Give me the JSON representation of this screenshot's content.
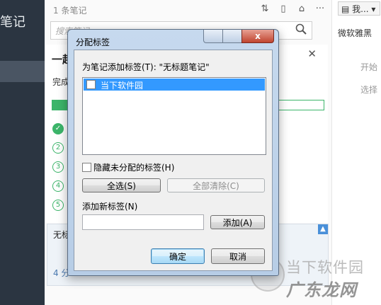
{
  "sidebar": {
    "title": "笔记"
  },
  "list": {
    "count": "1 条笔记",
    "search_placeholder": "搜索笔记",
    "icons": [
      "sort-icon",
      "view-icon",
      "tag-icon",
      "more-icon"
    ]
  },
  "onboard": {
    "heading": "一起",
    "subtext": "完成",
    "progress": 0.07,
    "steps": [
      "✓",
      "2",
      "3",
      "4",
      "5"
    ]
  },
  "card": {
    "title": "无标",
    "date": "4 分"
  },
  "editor": {
    "notebook": "我...",
    "font": "微软雅黑",
    "hint1": "开始",
    "hint2": "选择"
  },
  "dialog": {
    "title": "分配标签",
    "prompt": "为笔记添加标签(T): \"无标题笔记\"",
    "tags": [
      {
        "label": "当下软件园",
        "checked": false,
        "selected": true
      }
    ],
    "hide_unassigned": "隐藏未分配的标签(H)",
    "select_all": "全选(S)",
    "clear_all": "全部清除(C)",
    "new_tag_label": "添加新标签(N)",
    "new_tag_value": "",
    "add": "添加(A)",
    "ok": "确定",
    "cancel": "取消",
    "close_glyph": "x"
  },
  "watermark": {
    "line1": "当下软件园",
    "line2": "广东龙网"
  },
  "colors": {
    "accent": "#3cb56a",
    "selection": "#3399ff",
    "sidebar": "#2b3541"
  }
}
